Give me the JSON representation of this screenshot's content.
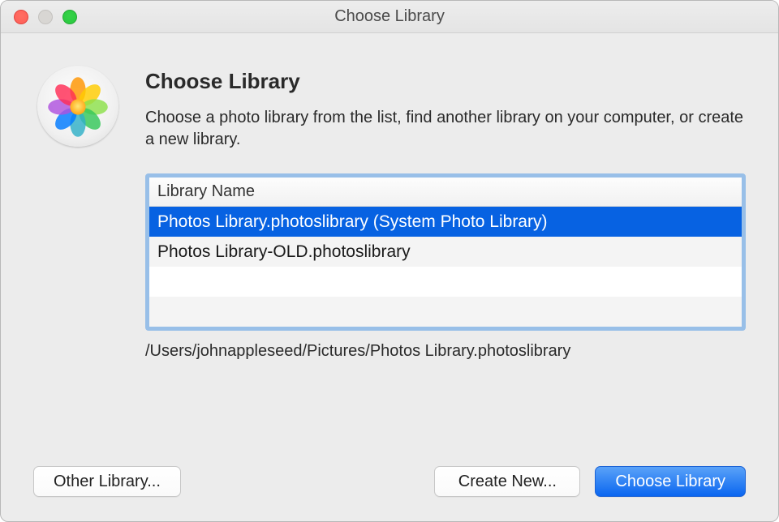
{
  "window": {
    "title": "Choose Library"
  },
  "header": {
    "title": "Choose Library",
    "description": "Choose a photo library from the list, find another library on your computer, or create a new library."
  },
  "list": {
    "column_header": "Library Name",
    "rows": [
      {
        "label": "Photos Library.photoslibrary (System Photo Library)",
        "selected": true
      },
      {
        "label": "Photos Library-OLD.photoslibrary",
        "selected": false
      },
      {
        "label": "",
        "selected": false
      },
      {
        "label": "",
        "selected": false
      }
    ],
    "selected_path": "/Users/johnappleseed/Pictures/Photos Library.photoslibrary"
  },
  "buttons": {
    "other_library": "Other Library...",
    "create_new": "Create New...",
    "choose_library": "Choose Library"
  },
  "icon": {
    "petal_colors": [
      "#ff9500",
      "#ffcc00",
      "#8ce04b",
      "#34c759",
      "#30b0c7",
      "#007aff",
      "#af52de",
      "#ff2d55"
    ],
    "center_start": "#ffe777",
    "center_end": "#ff9f0a"
  }
}
